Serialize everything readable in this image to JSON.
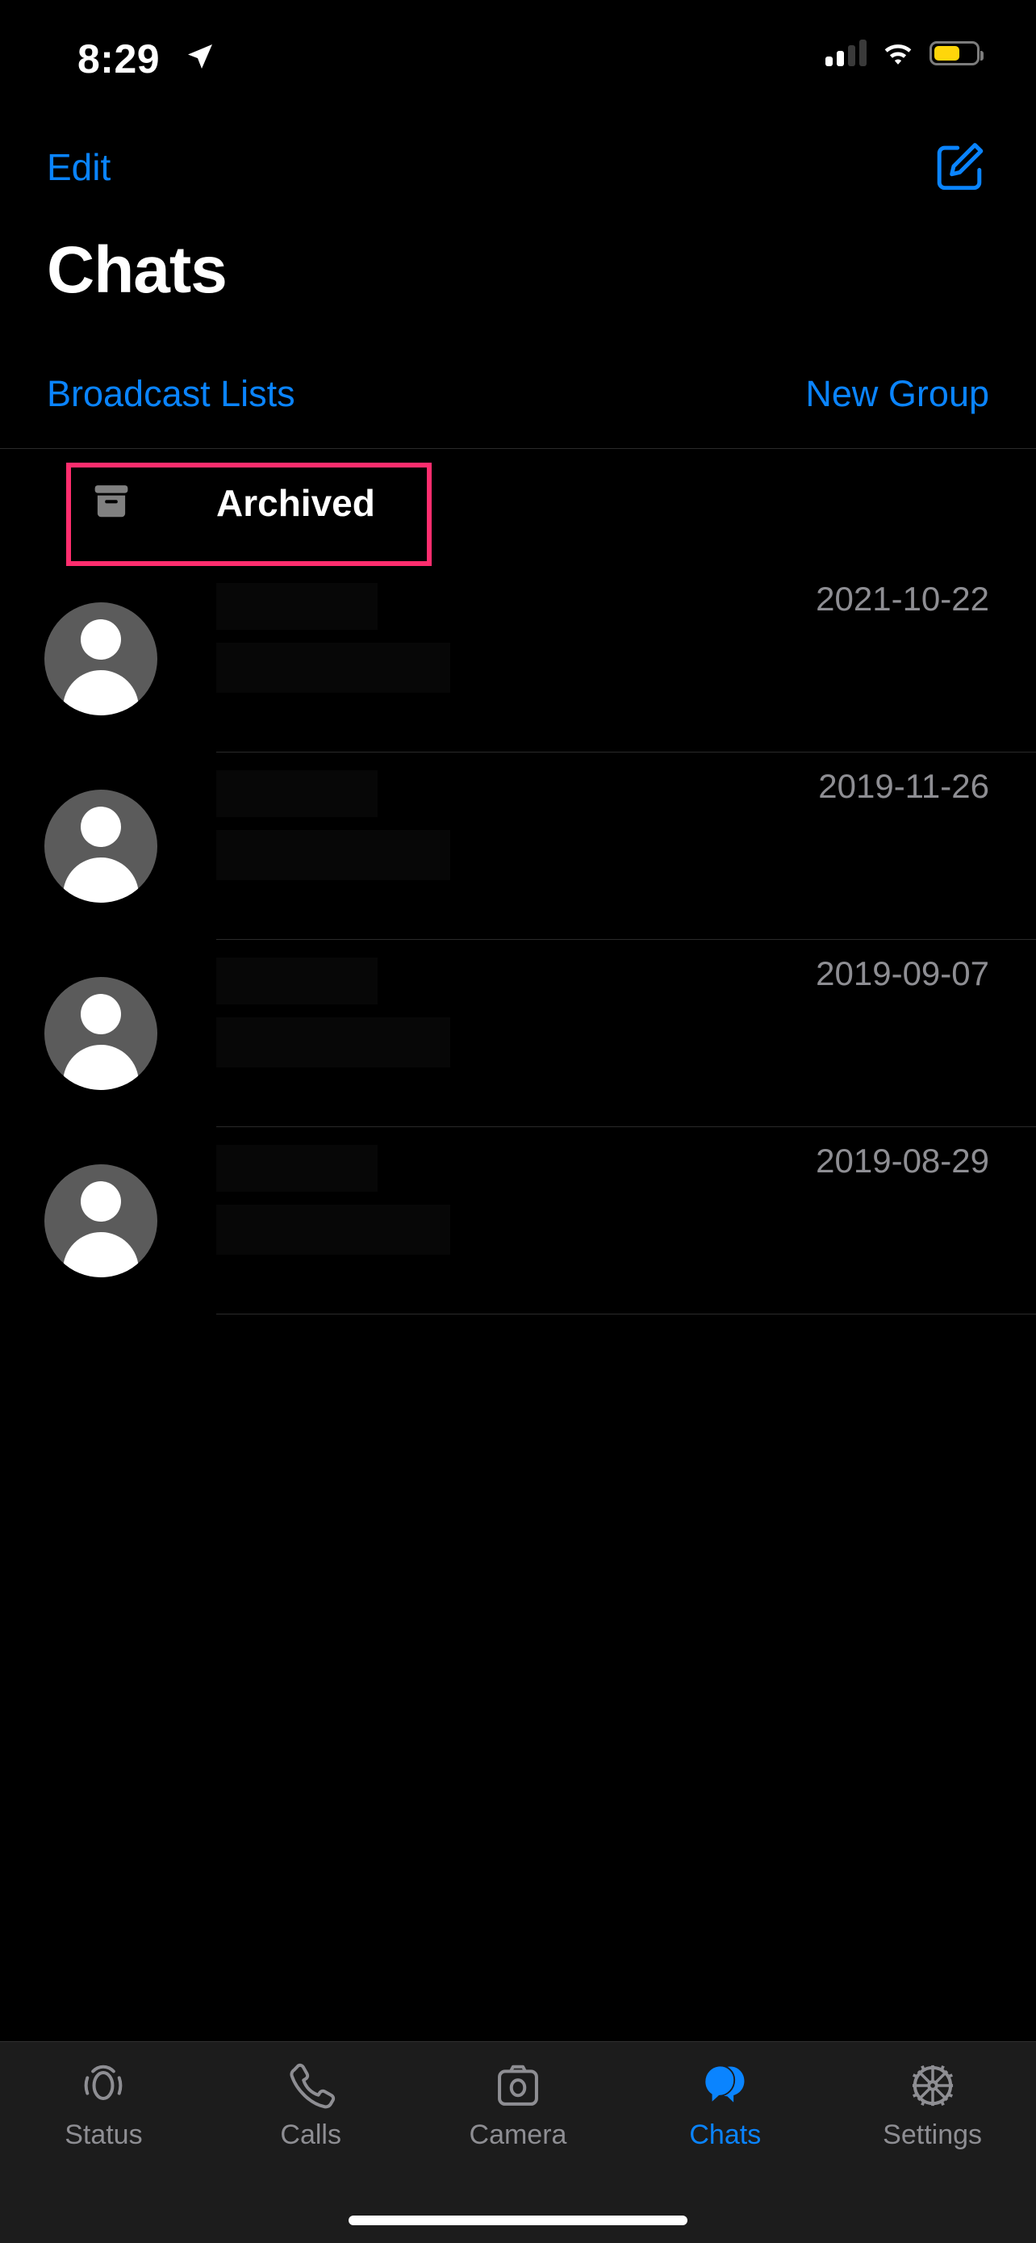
{
  "app": {
    "name": "WhatsApp"
  },
  "status_bar": {
    "time": "8:29",
    "location_icon": "location-arrow-icon",
    "cellular_icon": "cellular-signal-icon",
    "cellular_bars_filled": 2,
    "cellular_bars_total": 4,
    "wifi_icon": "wifi-icon",
    "battery_icon": "battery-icon",
    "battery_level_percent": 55,
    "battery_color": "#FFD60A"
  },
  "nav_bar": {
    "edit_label": "Edit",
    "compose_icon": "compose-new-chat-icon",
    "accent_color": "#0A84FF"
  },
  "header": {
    "title": "Chats"
  },
  "sub_actions": {
    "broadcast_label": "Broadcast Lists",
    "new_group_label": "New Group"
  },
  "archived": {
    "label": "Archived",
    "icon": "archive-box-icon",
    "highlight_color": "#FF2D6E",
    "highlighted": true
  },
  "chats": [
    {
      "name": "",
      "preview": "",
      "date": "2021-10-22",
      "avatar": "default-person-avatar"
    },
    {
      "name": "",
      "preview": "",
      "date": "2019-11-26",
      "avatar": "default-person-avatar"
    },
    {
      "name": "",
      "preview": "",
      "date": "2019-09-07",
      "avatar": "default-person-avatar"
    },
    {
      "name": "",
      "preview": "",
      "date": "2019-08-29",
      "avatar": "default-person-avatar"
    }
  ],
  "tab_bar": {
    "active_color": "#0A84FF",
    "inactive_color": "#8e8e93",
    "items": [
      {
        "label": "Status",
        "icon": "status-rings-icon",
        "active": false
      },
      {
        "label": "Calls",
        "icon": "phone-icon",
        "active": false
      },
      {
        "label": "Camera",
        "icon": "camera-icon",
        "active": false
      },
      {
        "label": "Chats",
        "icon": "chat-bubbles-icon",
        "active": true
      },
      {
        "label": "Settings",
        "icon": "gear-icon",
        "active": false
      }
    ]
  }
}
